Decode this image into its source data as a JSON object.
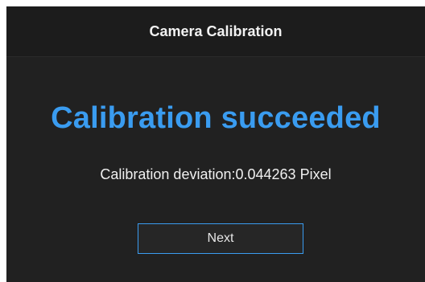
{
  "dialog": {
    "title": "Camera Calibration",
    "result_text": "Calibration succeeded",
    "deviation_text": "Calibration deviation:0.044263 Pixel",
    "next_label": "Next"
  },
  "colors": {
    "accent": "#3a9cf0",
    "background": "#212121",
    "titlebar": "#1c1c1c",
    "text": "#f0f0f0"
  }
}
